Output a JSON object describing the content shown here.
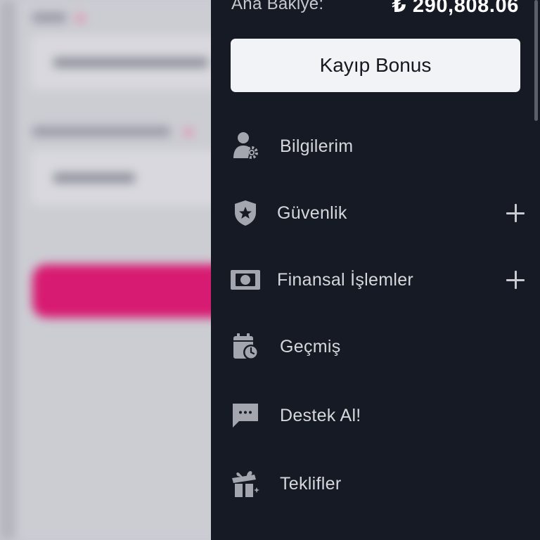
{
  "account": {
    "balance_label": "Ana Bakiye:",
    "balance_value": "₺ 290,808.06"
  },
  "bonus_button": {
    "label": "Kayıp Bonus"
  },
  "menu": {
    "items": [
      {
        "label": "Bilgilerim",
        "icon": "user-gear-icon",
        "expandable": false
      },
      {
        "label": "Güvenlik",
        "icon": "shield-star-icon",
        "expandable": true
      },
      {
        "label": "Finansal İşlemler",
        "icon": "banknote-icon",
        "expandable": true
      },
      {
        "label": "Geçmiş",
        "icon": "calendar-clock-icon",
        "expandable": false
      },
      {
        "label": "Destek Al!",
        "icon": "chat-bubble-icon",
        "expandable": false
      },
      {
        "label": "Teklifler",
        "icon": "gift-icon",
        "expandable": false
      }
    ]
  },
  "colors": {
    "drawer_bg": "#161a24",
    "button_bg": "#f2f3f6",
    "icon": "#a3a6ae",
    "background_cta": "#d81b72"
  }
}
